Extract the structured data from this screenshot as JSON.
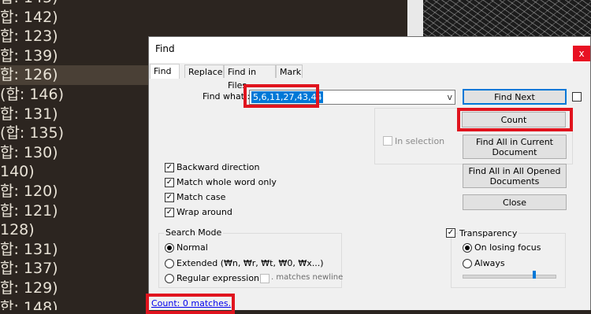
{
  "editor": {
    "lines": [
      {
        "text": "합: 145)"
      },
      {
        "text": "합: 142)"
      },
      {
        "text": "합: 123)"
      },
      {
        "text": "합: 139)"
      },
      {
        "text": "합: 126)"
      },
      {
        "text": "(합: 146)"
      },
      {
        "text": "합: 131)"
      },
      {
        "text": "(합: 135)"
      },
      {
        "text": "합: 130)"
      },
      {
        "text": "140)"
      },
      {
        "text": "합: 120)"
      },
      {
        "text": "합: 121)"
      },
      {
        "text": "128)"
      },
      {
        "text": "합: 131)"
      },
      {
        "text": "합: 137)"
      },
      {
        "text": "합: 129)"
      },
      {
        "text": "합: 148)"
      }
    ]
  },
  "dialog": {
    "title": "Find",
    "close_label": "x",
    "tabs": [
      {
        "label": "Find"
      },
      {
        "label": "Replace"
      },
      {
        "label": "Find in Files"
      },
      {
        "label": "Mark"
      }
    ],
    "find_what": {
      "label": "Find what :",
      "value": "5,6,11,27,43,44",
      "arrow": "v"
    },
    "buttons": {
      "find_next": "Find Next",
      "count": "Count",
      "find_all_current": "Find All in Current Document",
      "find_all_opened": "Find All in All Opened Documents",
      "close": "Close"
    },
    "in_selection": "In selection",
    "options": {
      "backward": "Backward direction",
      "whole_word": "Match whole word only",
      "match_case": "Match case",
      "wrap_around": "Wrap around"
    },
    "search_mode": {
      "title": "Search Mode",
      "normal": "Normal",
      "extended": "Extended (₩n, ₩r, ₩t, ₩0, ₩x...)",
      "regex": "Regular expression",
      "matches_newline": ". matches newline"
    },
    "transparency": {
      "title": "Transparency",
      "on_losing_focus": "On losing focus",
      "always": "Always",
      "level": 0.78
    },
    "status": "Count: 0 matches."
  }
}
